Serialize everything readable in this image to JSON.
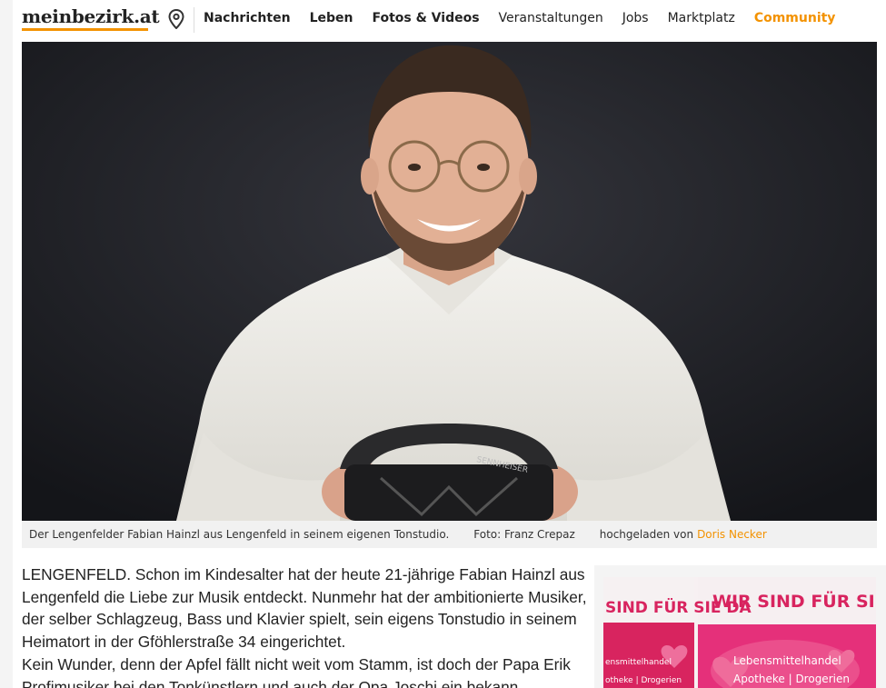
{
  "header": {
    "logo": "meinbezirk.at",
    "nav": [
      {
        "label": "Nachrichten",
        "style": "bold"
      },
      {
        "label": "Leben",
        "style": "bold"
      },
      {
        "label": "Fotos & Videos",
        "style": "bold"
      },
      {
        "label": "Veranstaltungen",
        "style": "normal"
      },
      {
        "label": "Jobs",
        "style": "normal"
      },
      {
        "label": "Marktplatz",
        "style": "normal"
      },
      {
        "label": "Community",
        "style": "community"
      }
    ]
  },
  "photo": {
    "headphone_brand": "SENNHEISER"
  },
  "caption": {
    "text": "Der Lengenfelder Fabian Hainzl aus Lengenfeld in seinem eigenen Tonstudio.",
    "credit": "Foto: Franz Crepaz",
    "uploaded_prefix": "hochgeladen von",
    "uploaded_by": "Doris Necker"
  },
  "article": {
    "paragraphs": [
      "LENGENFELD. Schon im Kindesalter hat der heute 21-jährige Fabian Hainzl aus Lengenfeld die Liebe zur Musik entdeckt. Nunmehr hat der ambitionierte Musiker, der selber Schlagzeug, Bass und Klavier spielt, sein eigens Tonstudio in seinem Heimatort in der Gföhlerstraße 34 eingerichtet.",
      "Kein Wunder, denn der Apfel fällt nicht weit vom Stamm, ist doch der Papa Erik Profimusiker bei den Tonkünstlern und auch der Opa Joschi ein bekann"
    ]
  },
  "ad": {
    "left_headline": "SIND FÜR SIE DA",
    "main_headline": "WIR SIND FÜR SIE D",
    "left_text_1": "ensmittelhandel",
    "left_text_2": "otheke | Drogerien",
    "main_text_1": "Lebensmittelhandel",
    "main_text_2": "Apotheke | Drogerien",
    "accent": "#e5307a"
  },
  "colors": {
    "brand": "#f39200"
  }
}
